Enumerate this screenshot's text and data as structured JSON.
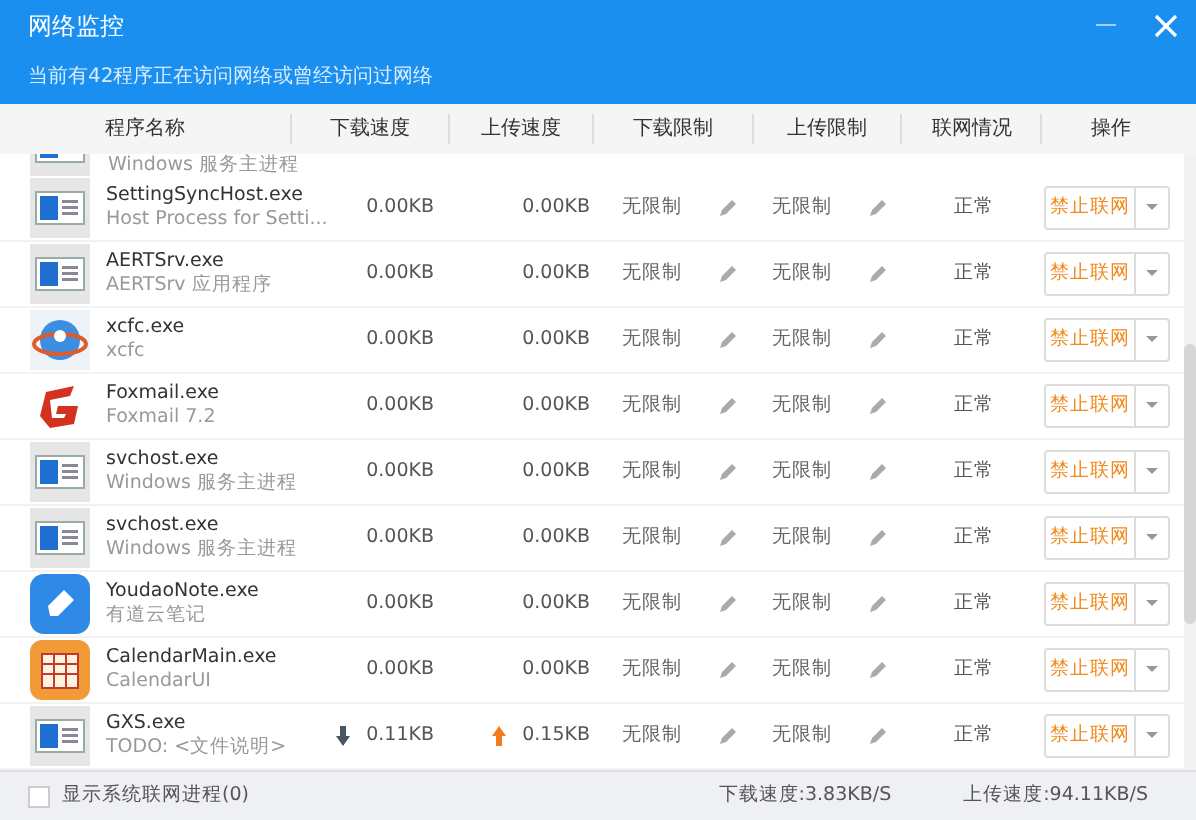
{
  "window": {
    "title": "网络监控",
    "subtitle": "当前有42程序正在访问网络或曾经访问过网络"
  },
  "table": {
    "columns": [
      "程序名称",
      "下载速度",
      "上传速度",
      "下载限制",
      "上传限制",
      "联网情况",
      "操作"
    ],
    "partial_row": {
      "description": "Windows 服务主进程",
      "kind": "window"
    },
    "rows": [
      {
        "kind": "window",
        "name": "SettingSyncHost.exe",
        "description": "Host Process for Setti...",
        "down": "0.00KB",
        "up": "0.00KB",
        "down_active": false,
        "up_active": false,
        "down_limit": "无限制",
        "up_limit": "无限制",
        "status": "正常",
        "action": "禁止联网"
      },
      {
        "kind": "window",
        "name": "AERTSrv.exe",
        "description": "AERTSrv 应用程序",
        "down": "0.00KB",
        "up": "0.00KB",
        "down_active": false,
        "up_active": false,
        "down_limit": "无限制",
        "up_limit": "无限制",
        "status": "正常",
        "action": "禁止联网"
      },
      {
        "kind": "globe",
        "name": "xcfc.exe",
        "description": "xcfc",
        "down": "0.00KB",
        "up": "0.00KB",
        "down_active": false,
        "up_active": false,
        "down_limit": "无限制",
        "up_limit": "无限制",
        "status": "正常",
        "action": "禁止联网"
      },
      {
        "kind": "mail",
        "name": "Foxmail.exe",
        "description": "Foxmail 7.2",
        "down": "0.00KB",
        "up": "0.00KB",
        "down_active": false,
        "up_active": false,
        "down_limit": "无限制",
        "up_limit": "无限制",
        "status": "正常",
        "action": "禁止联网"
      },
      {
        "kind": "window",
        "name": "svchost.exe",
        "description": "Windows 服务主进程",
        "down": "0.00KB",
        "up": "0.00KB",
        "down_active": false,
        "up_active": false,
        "down_limit": "无限制",
        "up_limit": "无限制",
        "status": "正常",
        "action": "禁止联网"
      },
      {
        "kind": "window",
        "name": "svchost.exe",
        "description": "Windows 服务主进程",
        "down": "0.00KB",
        "up": "0.00KB",
        "down_active": false,
        "up_active": false,
        "down_limit": "无限制",
        "up_limit": "无限制",
        "status": "正常",
        "action": "禁止联网"
      },
      {
        "kind": "note",
        "name": "YoudaoNote.exe",
        "description": "有道云笔记",
        "down": "0.00KB",
        "up": "0.00KB",
        "down_active": false,
        "up_active": false,
        "down_limit": "无限制",
        "up_limit": "无限制",
        "status": "正常",
        "action": "禁止联网"
      },
      {
        "kind": "calendar",
        "name": "CalendarMain.exe",
        "description": "CalendarUI",
        "down": "0.00KB",
        "up": "0.00KB",
        "down_active": false,
        "up_active": false,
        "down_limit": "无限制",
        "up_limit": "无限制",
        "status": "正常",
        "action": "禁止联网"
      },
      {
        "kind": "window",
        "name": "GXS.exe",
        "description": "TODO: <文件说明>",
        "down": "0.11KB",
        "up": "0.15KB",
        "down_active": true,
        "up_active": true,
        "down_limit": "无限制",
        "up_limit": "无限制",
        "status": "正常",
        "action": "禁止联网"
      }
    ]
  },
  "footer": {
    "show_system": {
      "label": "显示系统联网进程(0)",
      "checked": false
    },
    "download_speed": "下载速度:3.83KB/S",
    "upload_speed": "上传速度:94.11KB/S"
  }
}
